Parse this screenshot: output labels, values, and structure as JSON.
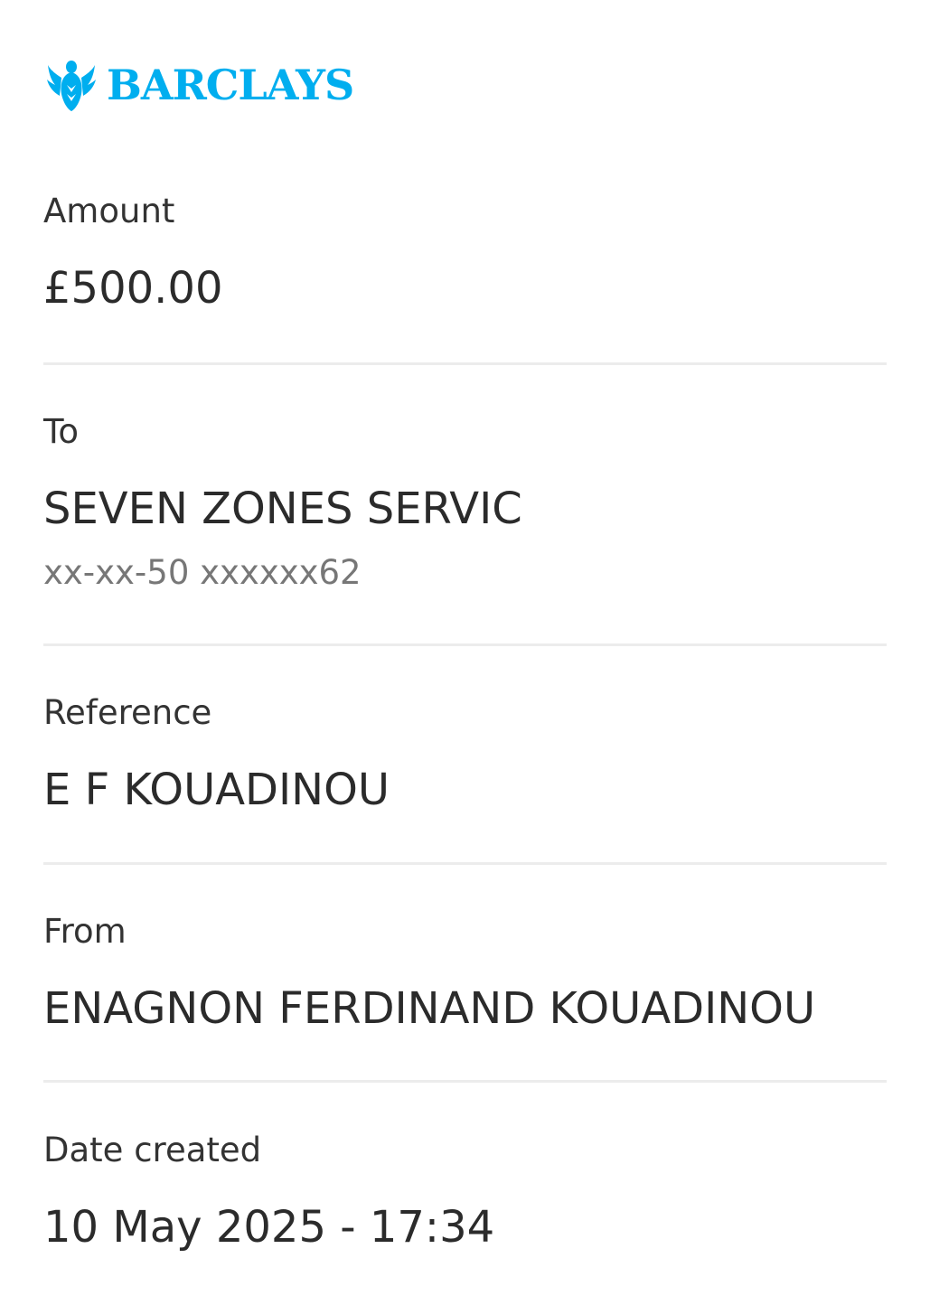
{
  "brand": {
    "name": "BARCLAYS",
    "logo_icon": "eagle-icon",
    "color": "#00aeef"
  },
  "amount": {
    "label": "Amount",
    "value": "£500.00"
  },
  "to": {
    "label": "To",
    "name": "SEVEN ZONES SERVIC",
    "account": "xx-xx-50 xxxxxx62"
  },
  "reference": {
    "label": "Reference",
    "value": "E F KOUADINOU"
  },
  "from": {
    "label": "From",
    "value": "ENAGNON FERDINAND KOUADINOU"
  },
  "date_created": {
    "label": "Date created",
    "value": "10 May 2025 - 17:34"
  }
}
